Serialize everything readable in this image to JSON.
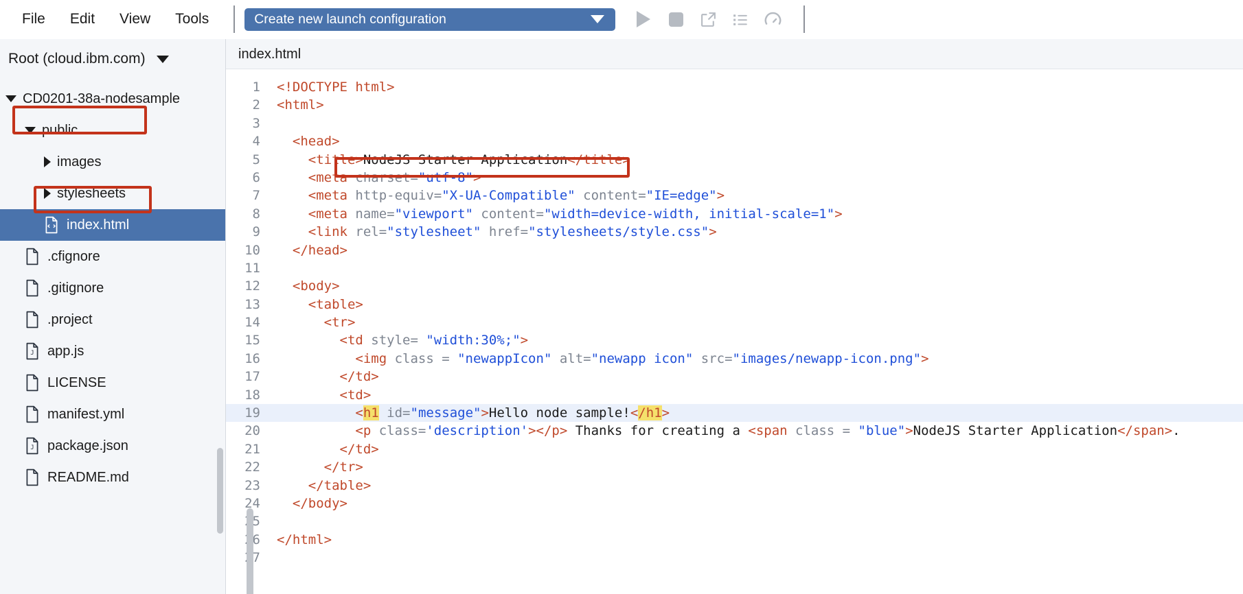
{
  "toolbar": {
    "menus": [
      {
        "label": "File",
        "name": "menu-file"
      },
      {
        "label": "Edit",
        "name": "menu-edit"
      },
      {
        "label": "View",
        "name": "menu-view"
      },
      {
        "label": "Tools",
        "name": "menu-tools"
      }
    ],
    "launch_config": {
      "value": "Create new launch configuration",
      "icon": "chevron-down-icon"
    },
    "buttons": [
      {
        "name": "run-button",
        "icon": "play-icon",
        "label": "Run"
      },
      {
        "name": "stop-button",
        "icon": "stop-icon",
        "label": "Stop"
      },
      {
        "name": "open-external-button",
        "icon": "external-link-icon",
        "label": "Open in new window"
      },
      {
        "name": "output-list-button",
        "icon": "list-icon",
        "label": "Output"
      },
      {
        "name": "gauge-button",
        "icon": "gauge-icon",
        "label": "Status"
      }
    ]
  },
  "sidebar": {
    "root_label": "Root (cloud.ibm.com)",
    "root_caret": "chevron-down-icon",
    "tree": [
      {
        "label": "CD0201-38a-nodesample",
        "indent": 0,
        "twisty": "open",
        "icon": "none",
        "selected": false,
        "highlighted": false
      },
      {
        "label": "public",
        "indent": 1,
        "twisty": "open",
        "icon": "none",
        "selected": false,
        "highlighted": true
      },
      {
        "label": "images",
        "indent": 2,
        "twisty": "closed",
        "icon": "none",
        "selected": false,
        "highlighted": false
      },
      {
        "label": "stylesheets",
        "indent": 2,
        "twisty": "closed",
        "icon": "none",
        "selected": false,
        "highlighted": false
      },
      {
        "label": "index.html",
        "indent": 2,
        "twisty": "none",
        "icon": "code-file-icon",
        "selected": true,
        "highlighted": true
      },
      {
        "label": ".cfignore",
        "indent": 1,
        "twisty": "none",
        "icon": "file-icon",
        "selected": false,
        "highlighted": false
      },
      {
        "label": ".gitignore",
        "indent": 1,
        "twisty": "none",
        "icon": "file-icon",
        "selected": false,
        "highlighted": false
      },
      {
        "label": ".project",
        "indent": 1,
        "twisty": "none",
        "icon": "file-icon",
        "selected": false,
        "highlighted": false
      },
      {
        "label": "app.js",
        "indent": 1,
        "twisty": "none",
        "icon": "js-file-icon",
        "selected": false,
        "highlighted": false
      },
      {
        "label": "LICENSE",
        "indent": 1,
        "twisty": "none",
        "icon": "file-icon",
        "selected": false,
        "highlighted": false
      },
      {
        "label": "manifest.yml",
        "indent": 1,
        "twisty": "none",
        "icon": "file-icon",
        "selected": false,
        "highlighted": false
      },
      {
        "label": "package.json",
        "indent": 1,
        "twisty": "none",
        "icon": "json-file-icon",
        "selected": false,
        "highlighted": false
      },
      {
        "label": "README.md",
        "indent": 1,
        "twisty": "none",
        "icon": "file-icon",
        "selected": false,
        "highlighted": false
      }
    ]
  },
  "editor": {
    "tab_label": "index.html",
    "highlighted_line": 19,
    "lines": [
      {
        "n": 1,
        "tokens": [
          {
            "t": "tag",
            "s": "<!DOCTYPE html>"
          }
        ]
      },
      {
        "n": 2,
        "tokens": [
          {
            "t": "tag",
            "s": "<html>"
          }
        ]
      },
      {
        "n": 3,
        "tokens": []
      },
      {
        "n": 4,
        "tokens": [
          {
            "t": "tag",
            "s": "  <head>"
          }
        ]
      },
      {
        "n": 5,
        "tokens": [
          {
            "t": "tag",
            "s": "    <title>"
          },
          {
            "t": "txt",
            "s": "NodeJS Starter Application"
          },
          {
            "t": "tag",
            "s": "</title>"
          }
        ]
      },
      {
        "n": 6,
        "tokens": [
          {
            "t": "tag",
            "s": "    <meta "
          },
          {
            "t": "attr",
            "s": "charset="
          },
          {
            "t": "val",
            "s": "\"utf-8\""
          },
          {
            "t": "tag",
            "s": ">"
          }
        ]
      },
      {
        "n": 7,
        "tokens": [
          {
            "t": "tag",
            "s": "    <meta "
          },
          {
            "t": "attr",
            "s": "http-equiv="
          },
          {
            "t": "val",
            "s": "\"X-UA-Compatible\""
          },
          {
            "t": "attr",
            "s": " content="
          },
          {
            "t": "val",
            "s": "\"IE=edge\""
          },
          {
            "t": "tag",
            "s": ">"
          }
        ]
      },
      {
        "n": 8,
        "tokens": [
          {
            "t": "tag",
            "s": "    <meta "
          },
          {
            "t": "attr",
            "s": "name="
          },
          {
            "t": "val",
            "s": "\"viewport\""
          },
          {
            "t": "attr",
            "s": " content="
          },
          {
            "t": "val",
            "s": "\"width=device-width, initial-scale=1\""
          },
          {
            "t": "tag",
            "s": ">"
          }
        ]
      },
      {
        "n": 9,
        "tokens": [
          {
            "t": "tag",
            "s": "    <link "
          },
          {
            "t": "attr",
            "s": "rel="
          },
          {
            "t": "val",
            "s": "\"stylesheet\""
          },
          {
            "t": "attr",
            "s": " href="
          },
          {
            "t": "val",
            "s": "\"stylesheets/style.css\""
          },
          {
            "t": "tag",
            "s": ">"
          }
        ]
      },
      {
        "n": 10,
        "tokens": [
          {
            "t": "tag",
            "s": "  </head>"
          }
        ]
      },
      {
        "n": 11,
        "tokens": []
      },
      {
        "n": 12,
        "tokens": [
          {
            "t": "tag",
            "s": "  <body>"
          }
        ]
      },
      {
        "n": 13,
        "tokens": [
          {
            "t": "tag",
            "s": "    <table>"
          }
        ]
      },
      {
        "n": 14,
        "tokens": [
          {
            "t": "tag",
            "s": "      <tr>"
          }
        ]
      },
      {
        "n": 15,
        "tokens": [
          {
            "t": "tag",
            "s": "        <td "
          },
          {
            "t": "attr",
            "s": "style= "
          },
          {
            "t": "val",
            "s": "\"width:30%;\""
          },
          {
            "t": "tag",
            "s": ">"
          }
        ]
      },
      {
        "n": 16,
        "tokens": [
          {
            "t": "tag",
            "s": "          <img "
          },
          {
            "t": "attr",
            "s": "class = "
          },
          {
            "t": "val",
            "s": "\"newappIcon\""
          },
          {
            "t": "attr",
            "s": " alt="
          },
          {
            "t": "val",
            "s": "\"newapp icon\""
          },
          {
            "t": "attr",
            "s": " src="
          },
          {
            "t": "val",
            "s": "\"images/newapp-icon.png\""
          },
          {
            "t": "tag",
            "s": ">"
          }
        ]
      },
      {
        "n": 17,
        "tokens": [
          {
            "t": "tag",
            "s": "        </td>"
          }
        ]
      },
      {
        "n": 18,
        "tokens": [
          {
            "t": "tag",
            "s": "        <td>"
          }
        ]
      },
      {
        "n": 19,
        "tokens": [
          {
            "t": "tag",
            "s": "          <"
          },
          {
            "t": "mark",
            "s": "h1"
          },
          {
            "t": "attr",
            "s": " id="
          },
          {
            "t": "val",
            "s": "\"message\""
          },
          {
            "t": "tag",
            "s": ">"
          },
          {
            "t": "txt",
            "s": "Hello node sample!"
          },
          {
            "t": "tag",
            "s": "<"
          },
          {
            "t": "mark",
            "s": "/h1"
          },
          {
            "t": "tag",
            "s": ">"
          }
        ]
      },
      {
        "n": 20,
        "tokens": [
          {
            "t": "tag",
            "s": "          <p "
          },
          {
            "t": "attr",
            "s": "class="
          },
          {
            "t": "val",
            "s": "'description'"
          },
          {
            "t": "tag",
            "s": "></p>"
          },
          {
            "t": "txt",
            "s": " Thanks for creating a "
          },
          {
            "t": "tag",
            "s": "<span "
          },
          {
            "t": "attr",
            "s": "class = "
          },
          {
            "t": "val",
            "s": "\"blue\""
          },
          {
            "t": "tag",
            "s": ">"
          },
          {
            "t": "txt",
            "s": "NodeJS Starter Application"
          },
          {
            "t": "tag",
            "s": "</span>"
          },
          {
            "t": "txt",
            "s": "."
          }
        ]
      },
      {
        "n": 21,
        "tokens": [
          {
            "t": "tag",
            "s": "        </td>"
          }
        ]
      },
      {
        "n": 22,
        "tokens": [
          {
            "t": "tag",
            "s": "      </tr>"
          }
        ]
      },
      {
        "n": 23,
        "tokens": [
          {
            "t": "tag",
            "s": "    </table>"
          }
        ]
      },
      {
        "n": 24,
        "tokens": [
          {
            "t": "tag",
            "s": "  </body>"
          }
        ]
      },
      {
        "n": 25,
        "tokens": []
      },
      {
        "n": 26,
        "tokens": [
          {
            "t": "tag",
            "s": "</html>"
          }
        ]
      },
      {
        "n": 27,
        "tokens": []
      }
    ]
  },
  "colors": {
    "accent_blue": "#4a73ac",
    "annotation_red": "#c3331b",
    "tag_orange": "#c0492b",
    "value_blue": "#1f4fd8",
    "attr_gray": "#7d8490",
    "sidebar_bg": "#f4f6f9",
    "tag_match_yellow": "#f5e06b"
  }
}
